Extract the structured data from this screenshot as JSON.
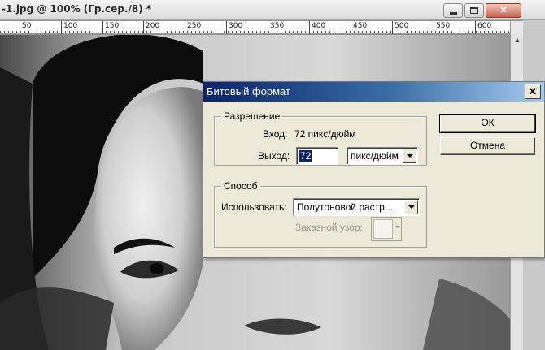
{
  "document": {
    "title": "-1.jpg @ 100% (Гр.сер./8) *",
    "window_controls": {
      "minimize": "minimize-icon",
      "maximize": "maximize-icon",
      "close": "✕"
    }
  },
  "ruler": {
    "labels": [
      "50",
      "100",
      "150",
      "200",
      "250",
      "300",
      "350",
      "400",
      "450",
      "500",
      "550",
      "600"
    ]
  },
  "dialog": {
    "title": "Битовый формат",
    "close_glyph": "✕",
    "resolution": {
      "legend": "Разрешение",
      "input_label": "Вход:",
      "input_value": "72 пикс/дюйм",
      "output_label": "Выход:",
      "output_value": "72",
      "output_unit": "пикс/дюйм"
    },
    "method": {
      "legend": "Способ",
      "use_label": "Использовать:",
      "use_value": "Полутоновой растр...",
      "pattern_label": "Заказной узор:"
    },
    "buttons": {
      "ok": "ОК",
      "cancel": "Отмена"
    }
  },
  "colors": {
    "dialog_bg": "#ece9d8",
    "titlebar_start": "#0a246a",
    "titlebar_end": "#a6caf0",
    "selection": "#0a246a"
  }
}
